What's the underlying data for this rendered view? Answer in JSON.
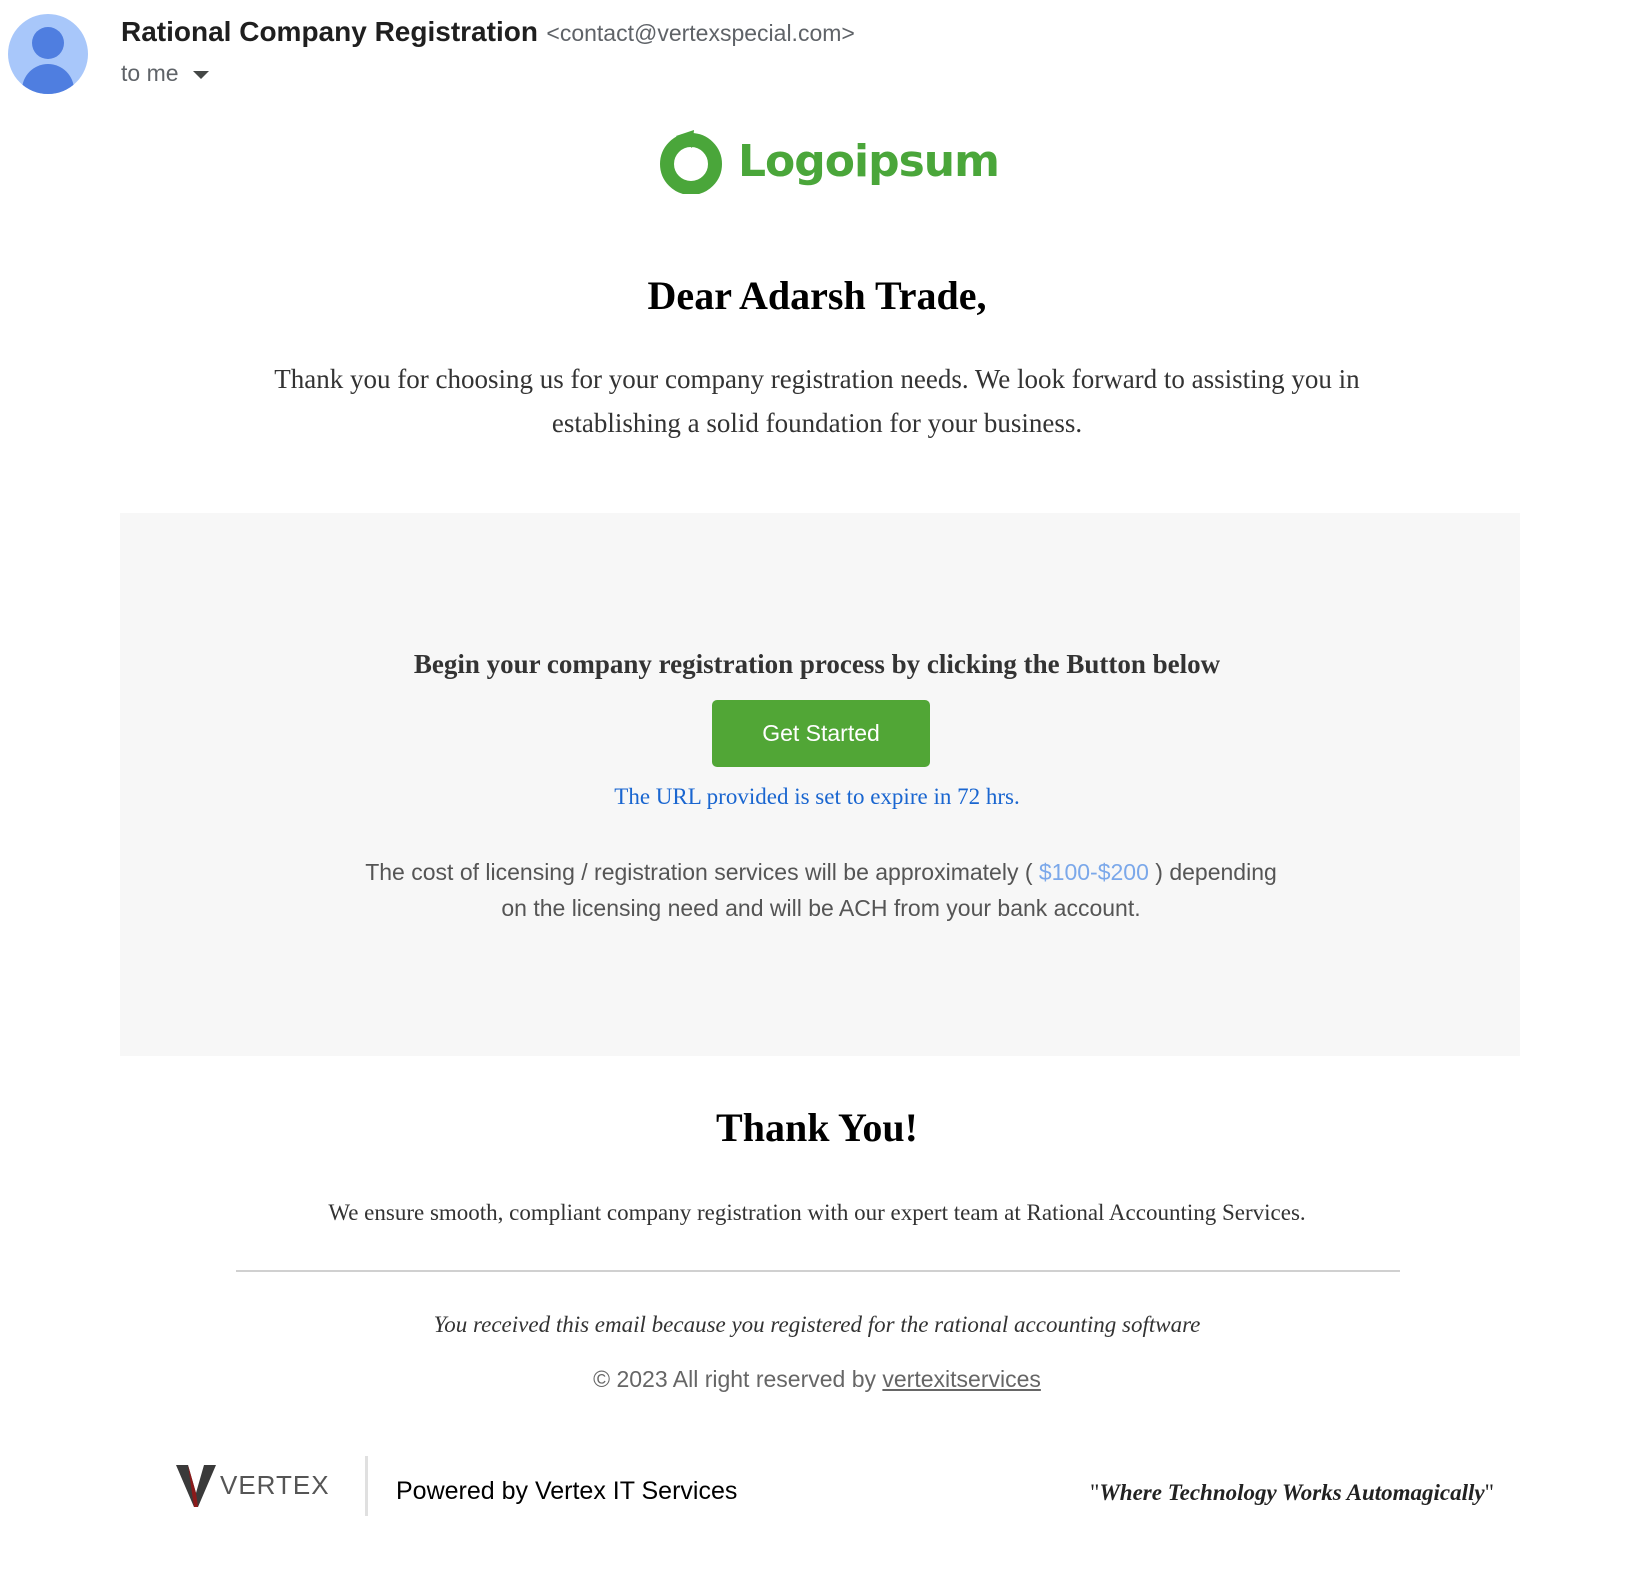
{
  "header": {
    "sender_name": "Rational Company Registration",
    "sender_email": "<contact@vertexspecial.com>",
    "recipient_label": "to me"
  },
  "logo": {
    "text": "Logoipsum"
  },
  "body": {
    "greeting": "Dear Adarsh Trade,",
    "intro": "Thank you for choosing us for your company registration needs. We look forward to assisting you in establishing a solid foundation for your business."
  },
  "card": {
    "heading": "Begin your company registration process by clicking the Button below",
    "button_label": "Get Started",
    "expiry_note": "The URL provided is set to expire in 72 hrs.",
    "cost_prefix": "The cost of licensing / registration services will be approximately (",
    "cost_range": "$100-$200",
    "cost_suffix": ") depending on the licensing need and will be ACH from your bank account."
  },
  "closing": {
    "thanks": "Thank You!",
    "ensure": "We ensure smooth, compliant company registration with our expert team at Rational Accounting Services.",
    "reason": "You received this email because you registered for the rational accounting software",
    "copyright_prefix": "© 2023 All right reserved by",
    "copyright_link": "vertexitservices"
  },
  "footer": {
    "vertex_brand": "VERTEX",
    "powered_by": "Powered by Vertex IT Services",
    "slogan_quote_open": "\"",
    "slogan": "Where Technology Works Automagically",
    "slogan_quote_close": "\""
  },
  "colors": {
    "brand_green": "#51a636",
    "link_blue": "#1a66d0",
    "price_blue": "#7ba8ea",
    "card_bg": "#f7f7f7",
    "avatar_bg": "#a8c7fa"
  },
  "icons": {
    "avatar": "person-avatar-icon",
    "recipient_caret": "caret-down-icon",
    "logo_mark": "logoipsum-ring-icon",
    "vertex_mark": "vertex-v-icon"
  }
}
